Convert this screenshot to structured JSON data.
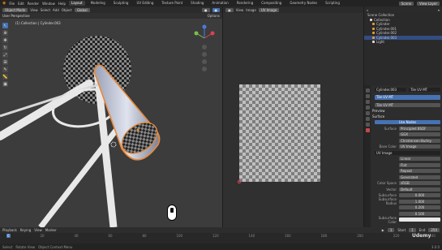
{
  "topbar": {
    "menus": [
      "File",
      "Edit",
      "Render",
      "Window",
      "Help"
    ],
    "tabs": [
      "Layout",
      "Modeling",
      "Sculpting",
      "UV Editing",
      "Texture Paint",
      "Shading",
      "Animation",
      "Rendering",
      "Compositing",
      "Geometry Nodes",
      "Scripting"
    ],
    "active_tab": "Layout",
    "scene": "Scene",
    "view_layer": "View Layer"
  },
  "viewport3d": {
    "mode": "Object Mode",
    "menus": [
      "View",
      "Select",
      "Add",
      "Object"
    ],
    "orientation": "Global",
    "label_line1": "User Perspective",
    "label_line2": "(1) Collection | Cylinder.003",
    "options": "Options"
  },
  "uv_editor": {
    "menus": [
      "View",
      "Image"
    ],
    "image_name": "UV Image"
  },
  "outliner": {
    "title": "Scene Collection",
    "items": [
      {
        "label": "Scene Collection",
        "selected": false
      },
      {
        "label": "Collection",
        "selected": false
      },
      {
        "label": "Cylinder",
        "selected": false
      },
      {
        "label": "Cylinder.001",
        "selected": false
      },
      {
        "label": "Cylinder.002",
        "selected": false
      },
      {
        "label": "Cylinder.003",
        "selected": true
      },
      {
        "label": "Light",
        "selected": false
      }
    ]
  },
  "properties": {
    "object_name": "Cylinder.003",
    "material_name": "Tile UV MT",
    "material_slot": "Tile UV MT",
    "section_preview": "Preview",
    "section_surface": "Surface",
    "use_nodes": "Use Nodes",
    "surface_label": "Surface",
    "surface_value": "Principled BSDF",
    "method_value": "GGX",
    "sss_value": "Christensen-Burley",
    "base_color_label": "Base Color",
    "base_color_value": "UV Image",
    "image_name": "UV Image",
    "interp": "Linear",
    "proj": "Flat",
    "ext": "Repeat",
    "source": "Generated",
    "color_space_label": "Color Space",
    "color_space": "sRGB",
    "vector_label": "Vector",
    "vector_value": "Default",
    "subsurface_label": "Subsurface",
    "subsurface_value": "0.000",
    "subsurface_radius_label": "Subsurface Radius",
    "radius_values": [
      "1.000",
      "0.200",
      "0.100"
    ],
    "subsurface_color_label": "Subsurface Color"
  },
  "timeline": {
    "menus": [
      "Playback",
      "Keying",
      "View",
      "Marker"
    ],
    "current_frame": "1",
    "start_label": "Start",
    "start": "1",
    "end_label": "End",
    "end": "250",
    "ticks": [
      "0",
      "20",
      "40",
      "60",
      "80",
      "100",
      "120",
      "140",
      "160",
      "180",
      "200",
      "220",
      "240"
    ]
  },
  "status": {
    "left": "Select",
    "mid": "Rotate View",
    "right": "Object Context Menu",
    "version": "3.0.0"
  },
  "watermark": "Udemy",
  "colors": {
    "accent": "#4772b3",
    "selection_outline": "#e8893a",
    "bg_viewport": "#3c3c3c"
  }
}
